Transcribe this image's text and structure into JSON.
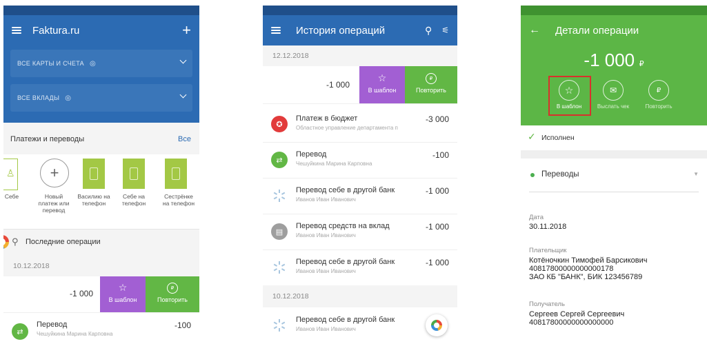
{
  "screen1": {
    "title": "Faktura.ru",
    "all_cards": "ВСЕ КАРТЫ И СЧЕТА",
    "all_deposits": "ВСЕ ВКЛАДЫ",
    "payments_title": "Платежи и переводы",
    "payments_all": "Все",
    "tiles": [
      {
        "label": "Себе"
      },
      {
        "label": "Новый\nплатеж или\nперевод"
      },
      {
        "label": "Василию на\nтелефон"
      },
      {
        "label": "Себе на\nтелефон"
      },
      {
        "label": "Сестрёнке\nна телефон"
      }
    ],
    "recent_ops": "Последние операции",
    "date": "10.12.2018",
    "swipe_amount": "-1 000",
    "swipe_template": "В шаблон",
    "swipe_repeat": "Повторить",
    "op_title": "Перевод",
    "op_sub": "Чешуйкина Марина Карповна",
    "op_amount": "-100"
  },
  "screen2": {
    "title": "История операций",
    "date1": "12.12.2018",
    "swipe_amount": "-1 000",
    "swipe_template": "В шаблон",
    "swipe_repeat": "Повторить",
    "ops": [
      {
        "title": "Платеж в бюджет",
        "sub": "Областное управление департамента п",
        "amount": "-3 000",
        "icon": "budget-icon",
        "color": "#e23b3b"
      },
      {
        "title": "Перевод",
        "sub": "Чешуйкина Марина Карповна",
        "amount": "-100",
        "icon": "transfer-icon",
        "color": "#62b745"
      },
      {
        "title": "Перевод себе в другой банк",
        "sub": "Иванов Иван Иванович",
        "amount": "-1 000",
        "icon": "spinner-icon",
        "color": ""
      },
      {
        "title": "Перевод средств на вклад",
        "sub": "Иванов Иван Иванович",
        "amount": "-1 000",
        "icon": "deposit-icon",
        "color": "#9e9e9e"
      },
      {
        "title": "Перевод себе в другой банк",
        "sub": "Иванов Иван Иванович",
        "amount": "-1 000",
        "icon": "spinner-icon",
        "color": ""
      }
    ],
    "date2": "10.12.2018",
    "last_op_title": "Перевод себе в другой банк",
    "last_op_sub": "Иванов Иван Иванович"
  },
  "screen3": {
    "title": "Детали операции",
    "amount": "-1 000",
    "currency": "₽",
    "action_template": "В шаблон",
    "action_receipt": "Выслать чек",
    "action_repeat": "Повторить",
    "status": "Исполнен",
    "category": "Переводы",
    "date_label": "Дата",
    "date_value": "30.11.2018",
    "payer_label": "Плательщик",
    "payer_name": "Котёночкин Тимофей Барсикович",
    "payer_account": "40817800000000000178",
    "payer_bank": "ЗАО КБ \"БАНК\", БИК 123456789",
    "recipient_label": "Получатель",
    "recipient_name": "Сергеев Сергей Сергеевич",
    "recipient_account": "40817800000000000000"
  },
  "colors": {
    "blue_bar": "#2c6bb3",
    "blue_status": "#1f4f8a",
    "green_bar": "#5cb646",
    "green_status": "#3f9230",
    "purple": "#a25fd3",
    "tile_green": "#a3c845",
    "highlight_red": "#d9302c"
  }
}
